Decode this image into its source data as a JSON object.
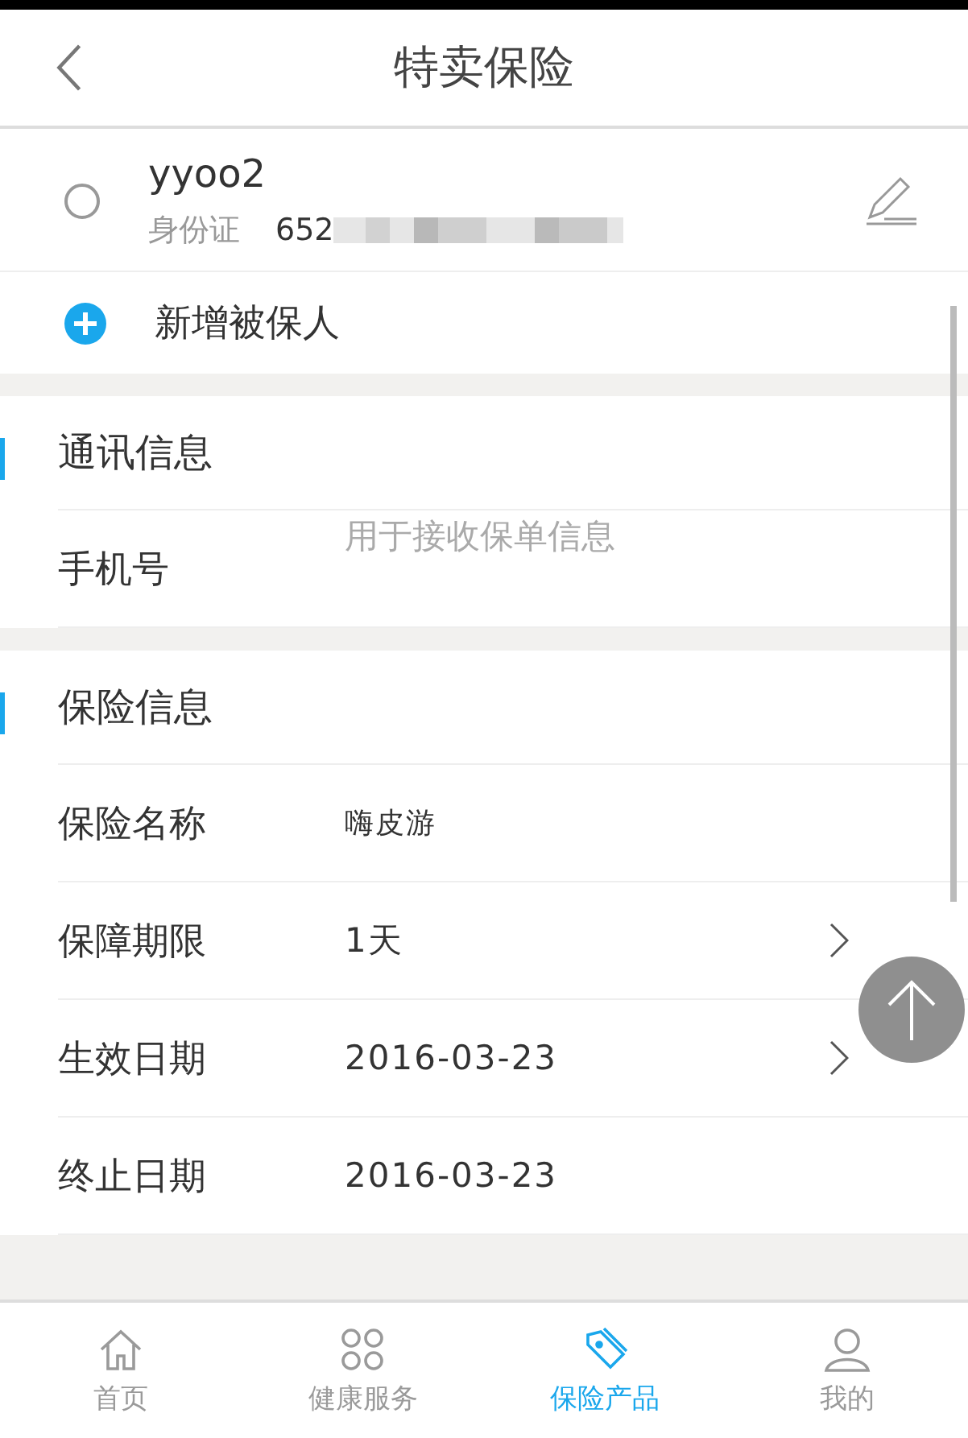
{
  "header": {
    "title": "特卖保险"
  },
  "insured": [
    {
      "name": "yyoo2",
      "id_label": "身份证",
      "id_number": "652",
      "selected": false
    }
  ],
  "add_insured": "新增被保人",
  "sections": [
    {
      "title": "通讯信息",
      "rows": [
        {
          "kind": "input",
          "label": "手机号",
          "placeholder": "用于接收保单信息"
        }
      ]
    },
    {
      "title": "保险信息",
      "rows": [
        {
          "kind": "text",
          "label": "保险名称",
          "value": "嗨皮游"
        },
        {
          "kind": "select",
          "label": "保障期限",
          "value": "1天"
        },
        {
          "kind": "select",
          "label": "生效日期",
          "value": "2016-03-23"
        },
        {
          "kind": "plain",
          "label": "终止日期",
          "value": "2016-03-23"
        }
      ]
    }
  ],
  "tab_bar": [
    {
      "label": "首页",
      "kind": "home",
      "selected": false
    },
    {
      "label": "健康服务",
      "kind": "grid",
      "selected": false
    },
    {
      "label": "保险产品",
      "kind": "tag",
      "selected": true
    },
    {
      "label": "我的",
      "kind": "user",
      "selected": false
    }
  ]
}
